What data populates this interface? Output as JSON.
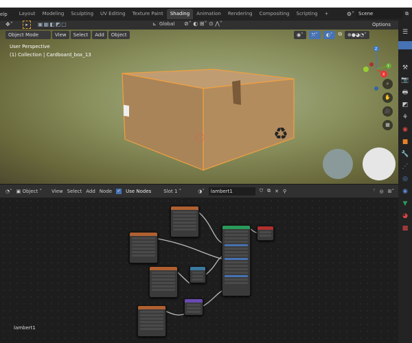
{
  "topbar": {
    "menu_fragment": "elp",
    "tabs": [
      "Layout",
      "Modeling",
      "Sculpting",
      "UV Editing",
      "Texture Paint",
      "Shading",
      "Animation",
      "Rendering",
      "Compositing",
      "Scripting"
    ],
    "active_tab": "Shading",
    "add_tab": "+",
    "scene": "Scene"
  },
  "toolbar": {
    "orientation": "Global",
    "options": "Options"
  },
  "viewport": {
    "mode": "Object Mode",
    "menus": [
      "View",
      "Select",
      "Add",
      "Object"
    ],
    "perspective": "User Perspective",
    "collection": "(1) Collection | Cardboard_box_13",
    "gizmo": {
      "x": "X",
      "y": "Y",
      "z": "Z"
    }
  },
  "node_editor": {
    "type": "Object",
    "menus": [
      "View",
      "Select",
      "Add",
      "Node"
    ],
    "use_nodes_label": "Use Nodes",
    "use_nodes": true,
    "slot": "Slot 1",
    "material": "lambert1",
    "footer_label": "lambert1"
  },
  "colors": {
    "accent": "#4772b3",
    "selected_outline": "#f0a040",
    "texture_node": "#b06030",
    "bsdf_node": "#2a9a5a",
    "output_node": "#b03030",
    "blue_node": "#3a7aa0",
    "purple_node": "#6a4ab0"
  }
}
